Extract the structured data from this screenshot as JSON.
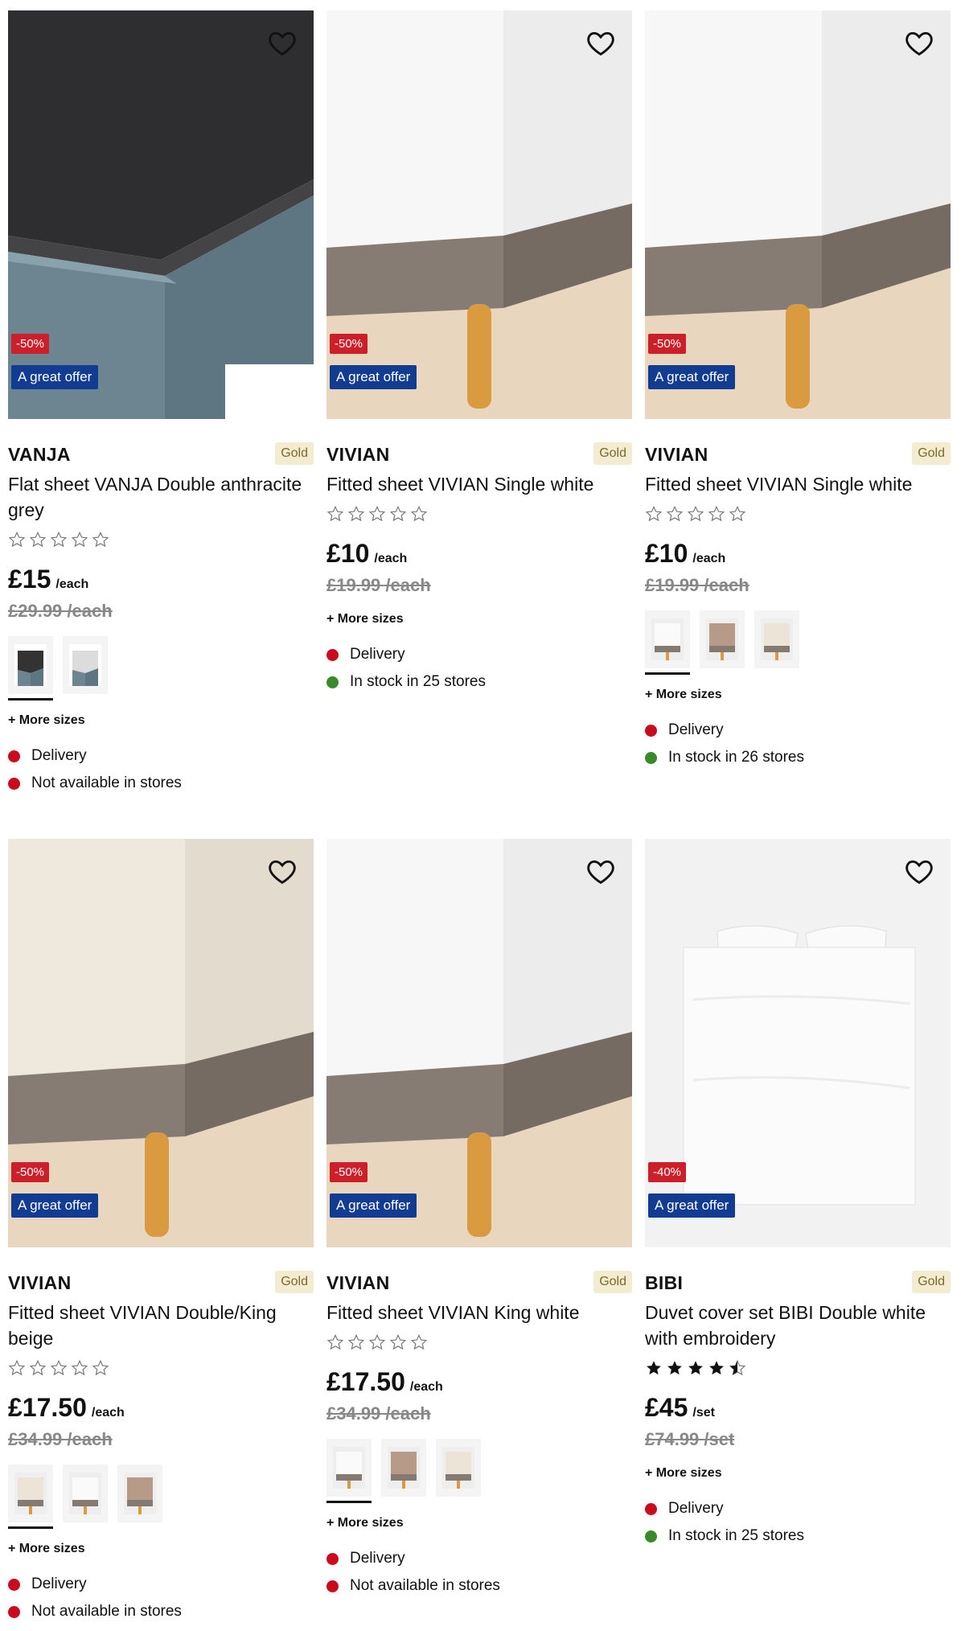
{
  "labels": {
    "offer": "A great offer",
    "gold": "Gold",
    "more_sizes": "+ More sizes",
    "delivery": "Delivery"
  },
  "products": [
    {
      "brand": "VANJA",
      "title": "Flat sheet VANJA Double anthracite grey",
      "discount": "-50%",
      "rating": 0,
      "price": "£15",
      "unit": "/each",
      "old_price": "£29.99 /each",
      "stock": "Not available in stores",
      "stock_status": "red",
      "swatch_count": 2
    },
    {
      "brand": "VIVIAN",
      "title": "Fitted sheet VIVIAN Single white",
      "discount": "-50%",
      "rating": 0,
      "price": "£10",
      "unit": "/each",
      "old_price": "£19.99 /each",
      "stock": "In stock in 25 stores",
      "stock_status": "green",
      "swatch_count": 0
    },
    {
      "brand": "VIVIAN",
      "title": "Fitted sheet VIVIAN Single white",
      "discount": "-50%",
      "rating": 0,
      "price": "£10",
      "unit": "/each",
      "old_price": "£19.99 /each",
      "stock": "In stock in 26 stores",
      "stock_status": "green",
      "swatch_count": 3
    },
    {
      "brand": "VIVIAN",
      "title": "Fitted sheet VIVIAN Double/King beige",
      "discount": "-50%",
      "rating": 0,
      "price": "£17.50",
      "unit": "/each",
      "old_price": "£34.99 /each",
      "stock": "Not available in stores",
      "stock_status": "red",
      "swatch_count": 3
    },
    {
      "brand": "VIVIAN",
      "title": "Fitted sheet VIVIAN King white",
      "discount": "-50%",
      "rating": 0,
      "price": "£17.50",
      "unit": "/each",
      "old_price": "£34.99 /each",
      "stock": "Not available in stores",
      "stock_status": "red",
      "swatch_count": 3
    },
    {
      "brand": "BIBI",
      "title": "Duvet cover set BIBI Double white with embroidery",
      "discount": "-40%",
      "rating": 4.5,
      "price": "£45",
      "unit": "/set",
      "old_price": "£74.99 /set",
      "stock": "In stock in 25 stores",
      "stock_status": "green",
      "swatch_count": 0
    }
  ],
  "colors": {
    "discount": "#cc1f2a",
    "offer": "#113c92",
    "gold_bg": "#f4ecd0",
    "red": "#cc0a1e",
    "green": "#3a8a2a"
  }
}
